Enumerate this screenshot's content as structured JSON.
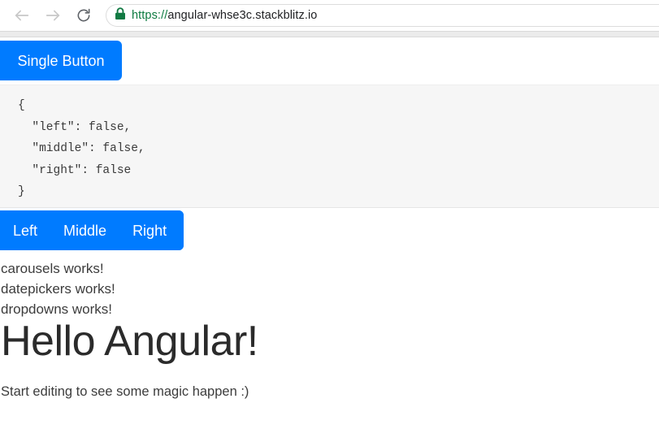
{
  "browser": {
    "back_icon": "back-arrow-icon",
    "forward_icon": "forward-arrow-icon",
    "reload_icon": "reload-icon",
    "lock_icon": "lock-icon",
    "url_scheme": "https://",
    "url_host": "angular-whse3c.stackblitz.io",
    "url_full": "https://angular-whse3c.stackblitz.io",
    "back_enabled": false,
    "forward_enabled": false
  },
  "page": {
    "single_button": {
      "label": "Single Button"
    },
    "json_output": {
      "line_open": "{",
      "line_left": "  \"left\": false,",
      "line_middle": "  \"middle\": false,",
      "line_right": "  \"right\": false",
      "line_close": "}",
      "values": {
        "left": false,
        "middle": false,
        "right": false
      }
    },
    "button_group": {
      "left_label": "Left",
      "middle_label": "Middle",
      "right_label": "Right"
    },
    "works_lines": [
      "carousels works!",
      "datepickers works!",
      "dropdowns works!"
    ],
    "heading": "Hello Angular!",
    "subtext": "Start editing to see some magic happen :)"
  },
  "colors": {
    "primary_blue": "#007bff",
    "panel_gray": "#f6f6f6",
    "lock_green": "#0b7a3f",
    "scheme_green": "#0b7a3f",
    "text_dark": "#3c3c3c"
  }
}
